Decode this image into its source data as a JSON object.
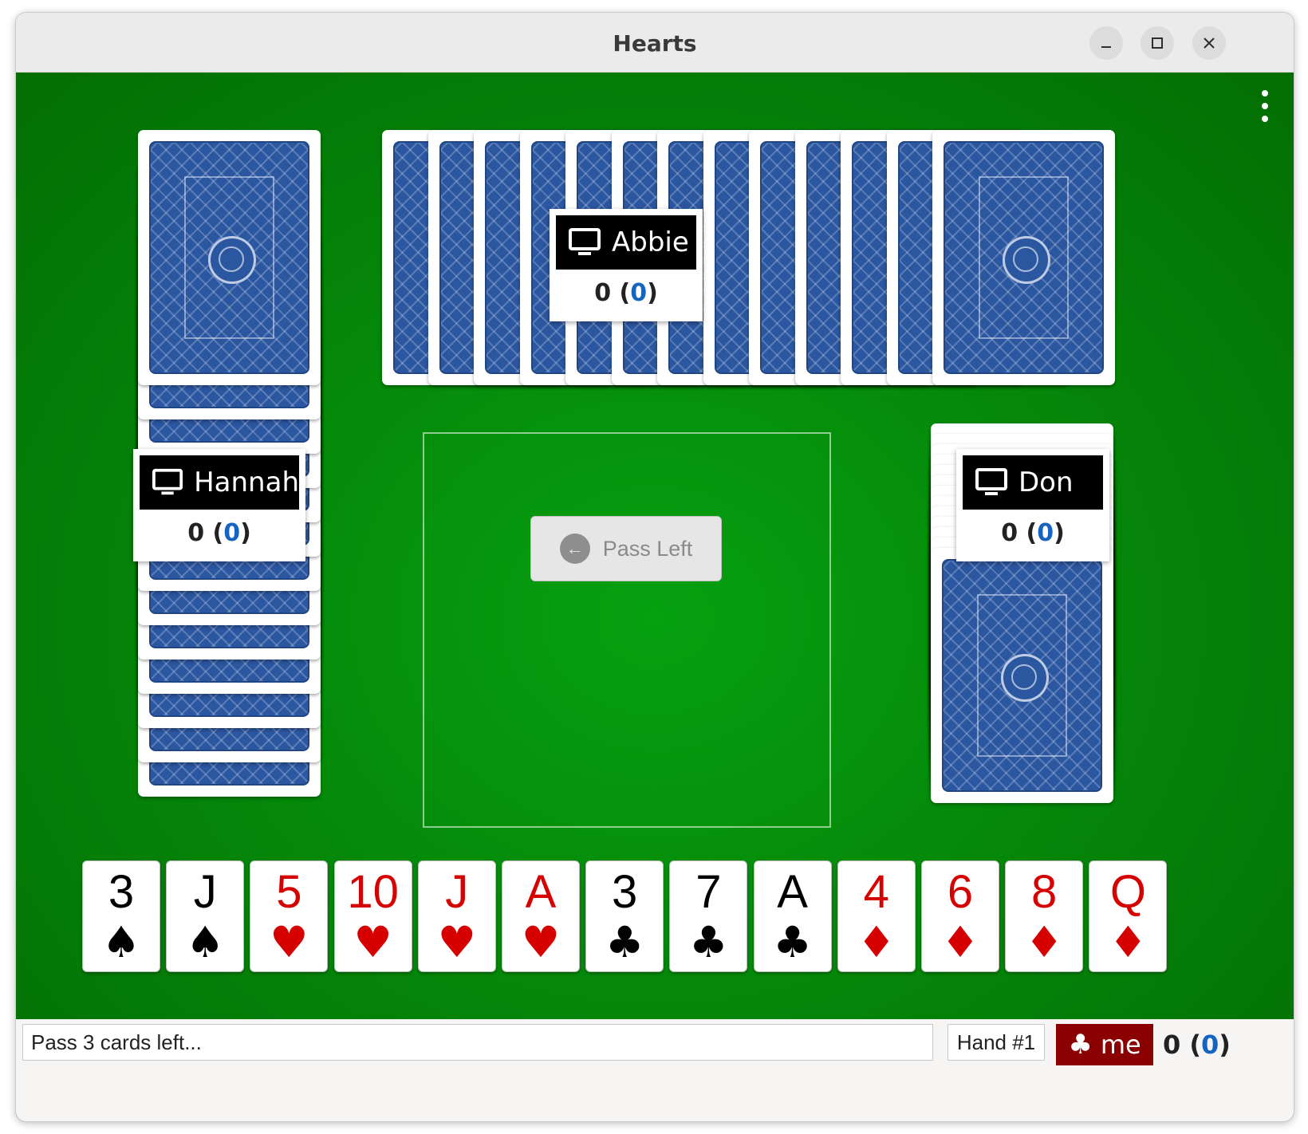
{
  "window": {
    "title": "Hearts"
  },
  "players": {
    "north": {
      "name": "Abbie",
      "score": "0",
      "round_score": "0",
      "icon": "computer-icon",
      "cards": 13
    },
    "west": {
      "name": "Hannah",
      "score": "0",
      "round_score": "0",
      "icon": "computer-icon",
      "cards": 13
    },
    "east": {
      "name": "Don",
      "score": "0",
      "round_score": "0",
      "icon": "computer-icon",
      "cards": 13
    }
  },
  "pass_button": {
    "label": "Pass Left",
    "icon": "arrow-left-icon"
  },
  "hand": [
    {
      "rank": "3",
      "suit": "♠",
      "color": "black"
    },
    {
      "rank": "J",
      "suit": "♠",
      "color": "black"
    },
    {
      "rank": "5",
      "suit": "♥",
      "color": "red"
    },
    {
      "rank": "10",
      "suit": "♥",
      "color": "red"
    },
    {
      "rank": "J",
      "suit": "♥",
      "color": "red"
    },
    {
      "rank": "A",
      "suit": "♥",
      "color": "red"
    },
    {
      "rank": "3",
      "suit": "♣",
      "color": "black"
    },
    {
      "rank": "7",
      "suit": "♣",
      "color": "black"
    },
    {
      "rank": "A",
      "suit": "♣",
      "color": "black"
    },
    {
      "rank": "4",
      "suit": "♦",
      "color": "red"
    },
    {
      "rank": "6",
      "suit": "♦",
      "color": "red"
    },
    {
      "rank": "8",
      "suit": "♦",
      "color": "red"
    },
    {
      "rank": "Q",
      "suit": "♦",
      "color": "red"
    }
  ],
  "status": {
    "message": "Pass 3 cards left...",
    "hand_number": "Hand #1",
    "me_label": "me",
    "me_suit": "♣",
    "me_score": "0",
    "me_round_score": "0"
  },
  "colors": {
    "table": "#058e0b",
    "card_back": "#2b56a0",
    "me_badge": "#8b0000",
    "red_suit": "#d60000"
  }
}
